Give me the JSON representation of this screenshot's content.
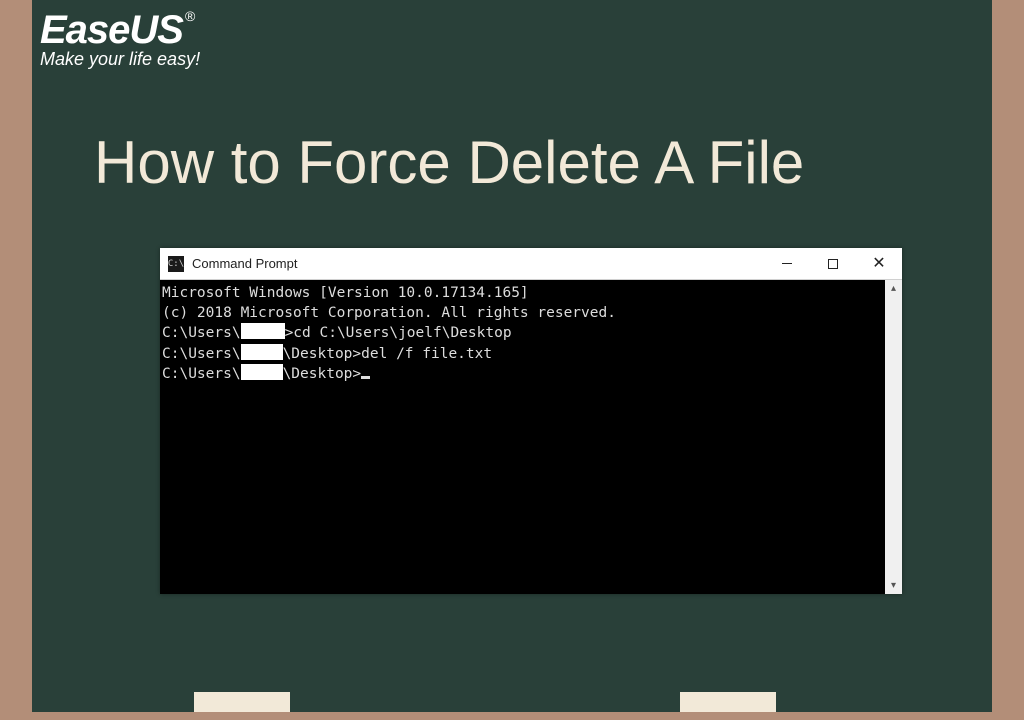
{
  "brand": {
    "name": "EaseUS",
    "registered": "®",
    "tagline": "Make your life easy!"
  },
  "headline": "How to Force Delete A File",
  "cmd_window": {
    "title": "Command Prompt",
    "icon_text": "C:\\"
  },
  "terminal": {
    "line1": "Microsoft Windows [Version 10.0.17134.165]",
    "line2": "(c) 2018 Microsoft Corporation. All rights reserved.",
    "blank": "",
    "p1_pre": "C:\\Users\\",
    "p1_post": ">cd C:\\Users\\joelf\\Desktop",
    "p2_pre": "C:\\Users\\",
    "p2_mid": "\\Desktop>del /f file.txt",
    "p3_pre": "C:\\Users\\",
    "p3_mid": "\\Desktop>"
  }
}
